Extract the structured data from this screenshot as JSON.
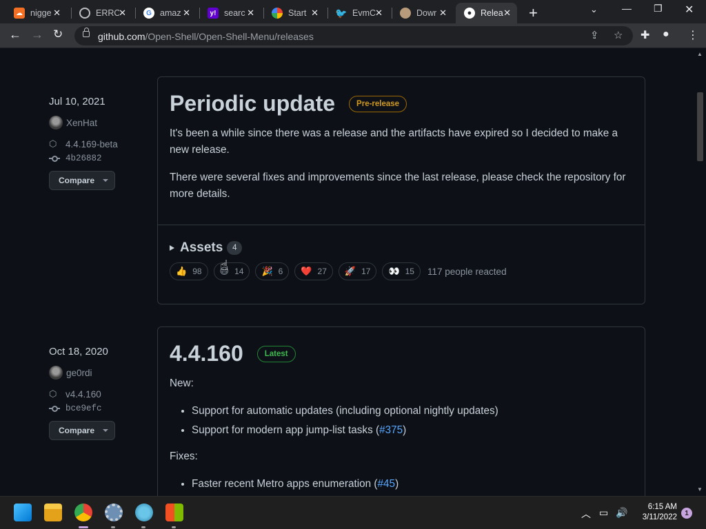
{
  "browser": {
    "tabs": [
      {
        "title": "nigge",
        "favicon": "soundcloud-icon",
        "color": "#f26f23"
      },
      {
        "title": "ERRO",
        "favicon": "globe-icon",
        "color": "#5f6368"
      },
      {
        "title": "amaz",
        "favicon": "google-icon",
        "color": "#ffffff"
      },
      {
        "title": "searc",
        "favicon": "yahoo-icon",
        "color": "#6001d2"
      },
      {
        "title": "Start",
        "favicon": "start-icon",
        "color": "#4caf50"
      },
      {
        "title": "EvmC",
        "favicon": "twitter-icon",
        "color": "#1d9bf0"
      },
      {
        "title": "Dowr",
        "favicon": "avatar-icon",
        "color": "#b89b7a"
      },
      {
        "title": "Relea",
        "favicon": "github-icon",
        "color": "#ffffff"
      }
    ],
    "url_host": "github.com",
    "url_path": "/Open-Shell/Open-Shell-Menu/releases"
  },
  "releases": [
    {
      "date": "Jul 10, 2021",
      "author": "XenHat",
      "tag": "4.4.169-beta",
      "commit": "4b26882",
      "compare_label": "Compare",
      "title": "Periodic update",
      "badge": "Pre-release",
      "paragraphs": [
        "It's been a while since there was a release and the artifacts have expired so I decided to make a new release.",
        "There were several fixes and improvements since the last release, please check the repository for more details."
      ],
      "assets_label": "Assets",
      "assets_count": "4",
      "reactions": [
        {
          "emoji": "👍",
          "count": "98"
        },
        {
          "emoji": "😄",
          "count": "14"
        },
        {
          "emoji": "🎉",
          "count": "6"
        },
        {
          "emoji": "❤️",
          "count": "27"
        },
        {
          "emoji": "🚀",
          "count": "17"
        },
        {
          "emoji": "👀",
          "count": "15"
        }
      ],
      "reacted_text": "117 people reacted"
    },
    {
      "date": "Oct 18, 2020",
      "author": "ge0rdi",
      "tag": "v4.4.160",
      "commit": "bce9efc",
      "compare_label": "Compare",
      "title": "4.4.160",
      "badge": "Latest",
      "section_new": "New:",
      "new_items": [
        {
          "text": "Support for automatic updates (including optional nightly updates)",
          "link": ""
        },
        {
          "text": "Support for modern app jump-list tasks (",
          "link": "#375",
          "after": ")"
        }
      ],
      "section_fixes": "Fixes:",
      "fix_items": [
        {
          "text": "Faster recent Metro apps enumeration (",
          "link": "#45",
          "after": ")"
        }
      ]
    }
  ],
  "taskbar": {
    "time": "6:15 AM",
    "date": "3/11/2022",
    "notifications": "1"
  }
}
